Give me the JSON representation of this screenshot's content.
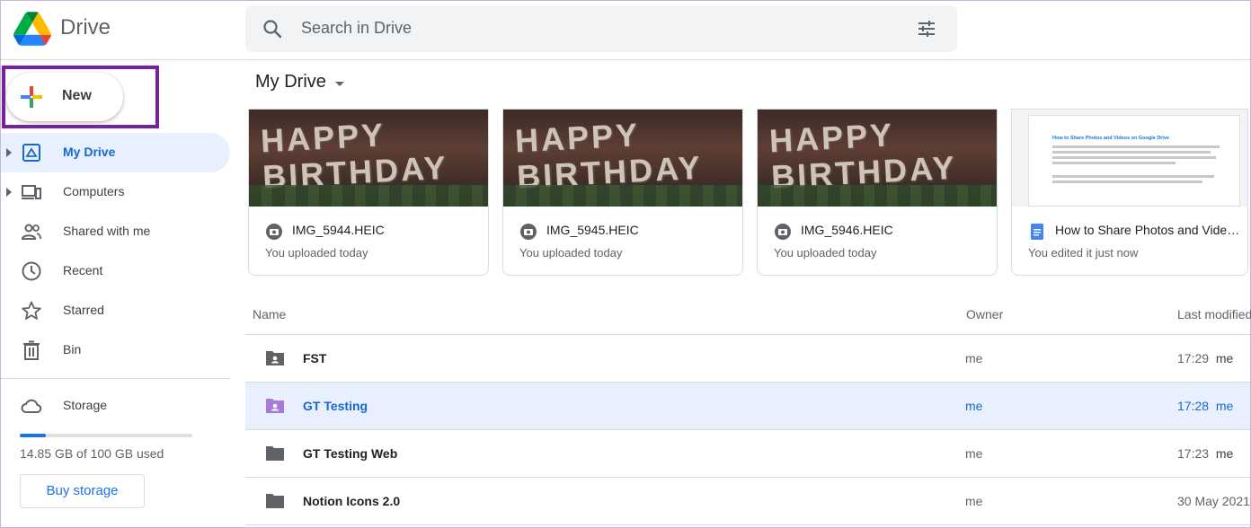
{
  "header": {
    "app_name": "Drive",
    "search_placeholder": "Search in Drive"
  },
  "sidebar": {
    "new_label": "New",
    "items": [
      {
        "label": "My Drive",
        "icon": "my-drive-icon",
        "active": true
      },
      {
        "label": "Computers",
        "icon": "computers-icon"
      },
      {
        "label": "Shared with me",
        "icon": "shared-icon"
      },
      {
        "label": "Recent",
        "icon": "clock-icon"
      },
      {
        "label": "Starred",
        "icon": "star-icon"
      },
      {
        "label": "Bin",
        "icon": "trash-icon"
      }
    ],
    "storage_label": "Storage",
    "storage_used_fraction": 0.1485,
    "storage_text": "14.85 GB of 100 GB used",
    "buy_label": "Buy storage"
  },
  "main": {
    "title": "My Drive",
    "suggested": [
      {
        "name": "IMG_5944.HEIC",
        "sub": "You uploaded today",
        "type": "photo",
        "balloons": "HAPPY\nBIRTHDAY"
      },
      {
        "name": "IMG_5945.HEIC",
        "sub": "You uploaded today",
        "type": "photo",
        "balloons": "HAPPY\nBIRTHDAY"
      },
      {
        "name": "IMG_5946.HEIC",
        "sub": "You uploaded today",
        "type": "photo",
        "balloons": "HAPPY\nBIRTHDAY"
      },
      {
        "name": "How to Share Photos and Videos on Google Drive",
        "sub": "You edited it just now",
        "type": "doc",
        "doc_heading": "How to Share Photos and Videos on Google Drive"
      }
    ],
    "columns": {
      "name": "Name",
      "owner": "Owner",
      "modified": "Last modified"
    },
    "rows": [
      {
        "name": "FST",
        "owner": "me",
        "time": "17:29",
        "by": "me",
        "shared": true
      },
      {
        "name": "GT Testing",
        "owner": "me",
        "time": "17:28",
        "by": "me",
        "shared": true,
        "selected": true
      },
      {
        "name": "GT Testing Web",
        "owner": "me",
        "time": "17:23",
        "by": "me"
      },
      {
        "name": "Notion Icons 2.0",
        "owner": "me",
        "time": "30 May 2021",
        "by": ""
      }
    ]
  },
  "colors": {
    "accent": "#1a73e8",
    "highlight": "#7b1fa2",
    "selected_folder": "#a979d6"
  }
}
